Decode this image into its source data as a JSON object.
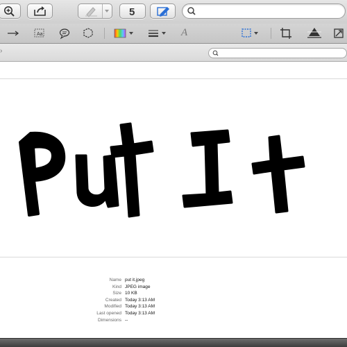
{
  "toolbar": {
    "search_placeholder": "",
    "rotate_count": "5"
  },
  "markup": {
    "text_tool_label": "A"
  },
  "sidebar_search": {
    "placeholder": ""
  },
  "document": {
    "handwritten_text": "Put It"
  },
  "info": {
    "rows": [
      {
        "key": "Name",
        "value": "put it.jpeg"
      },
      {
        "key": "Kind",
        "value": "JPEG image"
      },
      {
        "key": "Size",
        "value": "10 KB"
      },
      {
        "key": "Created",
        "value": "Today 3:13 AM"
      },
      {
        "key": "Modified",
        "value": "Today 3:13 AM"
      },
      {
        "key": "Last opened",
        "value": "Today 3:13 AM"
      },
      {
        "key": "Dimensions",
        "value": "--"
      }
    ]
  },
  "colors": {
    "toolbar_top": "#e6e6e6",
    "toolbar_bottom": "#cfcfcf",
    "accent_blue": "#2a6fd6"
  },
  "icons": {
    "zoom": "zoom-in-icon",
    "share": "share-icon",
    "highlight": "highlight-icon",
    "rotate": "rotate-icon",
    "markup_toggle": "markup-toggle-icon",
    "search": "search-icon",
    "arrow": "arrow-tool-icon",
    "text_box": "text-box-icon",
    "speech_bubble": "speech-bubble-icon",
    "shape": "shape-tool-icon",
    "color": "color-picker-icon",
    "line_weight": "line-weight-icon",
    "font": "font-icon",
    "selection": "selection-icon",
    "crop": "crop-icon",
    "adjust": "adjust-color-icon",
    "resize": "resize-icon"
  }
}
